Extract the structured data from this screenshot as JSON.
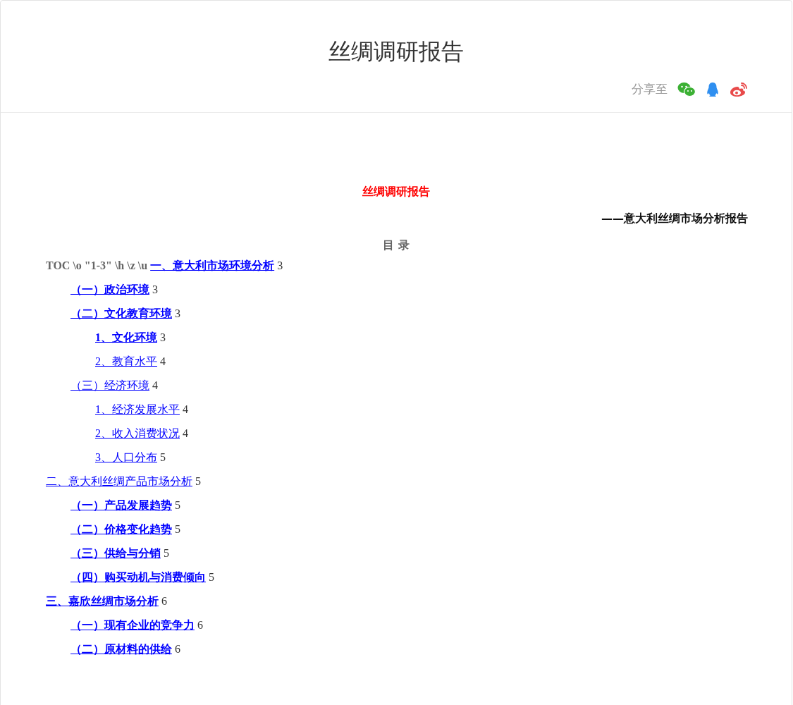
{
  "header": {
    "title": "丝绸调研报告",
    "share_label": "分享至"
  },
  "document": {
    "title": "丝绸调研报告",
    "subtitle": "——意大利丝绸市场分析报告",
    "toc_heading": "目 录",
    "toc_field_code": "TOC \\o \"1-3\" \\h \\z \\u",
    "toc": [
      {
        "label": "一、意大利市场环境分析",
        "page": "3",
        "bold": true,
        "children": [
          {
            "label": "（一）政治环境",
            "page": "3",
            "bold": true
          },
          {
            "label": "（二）文化教育环境",
            "page": "3",
            "bold": true,
            "children": [
              {
                "label": "1、文化环境",
                "page": "3",
                "bold": true
              },
              {
                "label": "2、教育水平",
                "page": "4",
                "bold": false
              }
            ]
          },
          {
            "label": "（三）经济环境",
            "page": "4",
            "bold": false,
            "children": [
              {
                "label": "1、经济发展水平",
                "page": "4",
                "bold": false
              },
              {
                "label": "2、收入消费状况",
                "page": "4",
                "bold": false
              },
              {
                "label": "3、人口分布",
                "page": "5",
                "bold": false
              }
            ]
          }
        ]
      },
      {
        "label": "二、意大利丝绸产品市场分析",
        "page": "5",
        "bold": false,
        "children": [
          {
            "label": "（一）产品发展趋势",
            "page": "5",
            "bold": true
          },
          {
            "label": "（二）价格变化趋势",
            "page": "5",
            "bold": true
          },
          {
            "label": "（三）供给与分销",
            "page": "5",
            "bold": true
          },
          {
            "label": "（四）购买动机与消费倾向",
            "page": "5",
            "bold": true
          }
        ]
      },
      {
        "label": "三、嘉欣丝绸市场分析",
        "page": "6",
        "bold": true,
        "children": [
          {
            "label": "（一）现有企业的竞争力",
            "page": "6",
            "bold": true
          },
          {
            "label": "（二）原材料的供给",
            "page": "6",
            "bold": true
          }
        ]
      }
    ]
  }
}
